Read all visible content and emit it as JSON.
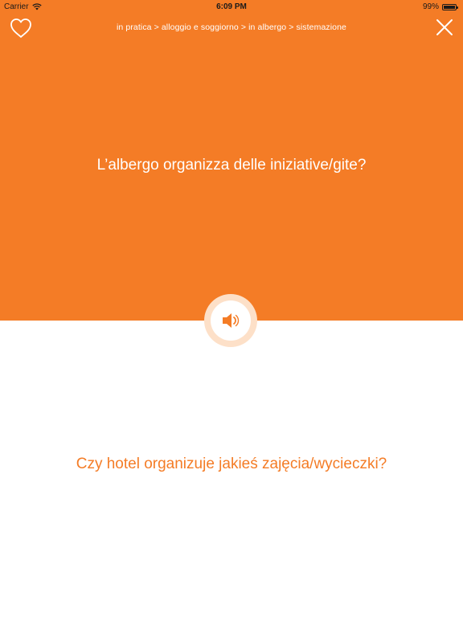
{
  "status_bar": {
    "carrier": "Carrier",
    "time": "6:09 PM",
    "battery_percent": "99%",
    "battery_level": 0.99,
    "wifi_icon": "wifi-icon"
  },
  "header": {
    "favorite_icon": "heart-icon",
    "breadcrumb": "in pratica > alloggio e soggiorno > in albergo > sistemazione",
    "close_icon": "close-icon"
  },
  "card": {
    "phrase": "L’albergo organizza delle iniziative/gite?",
    "speaker_icon": "speaker-icon",
    "translation": "Czy hotel organizuje jakieś zajęcia/wycieczki?"
  },
  "colors": {
    "accent": "#f47c26",
    "ring": "#fde0c8"
  }
}
